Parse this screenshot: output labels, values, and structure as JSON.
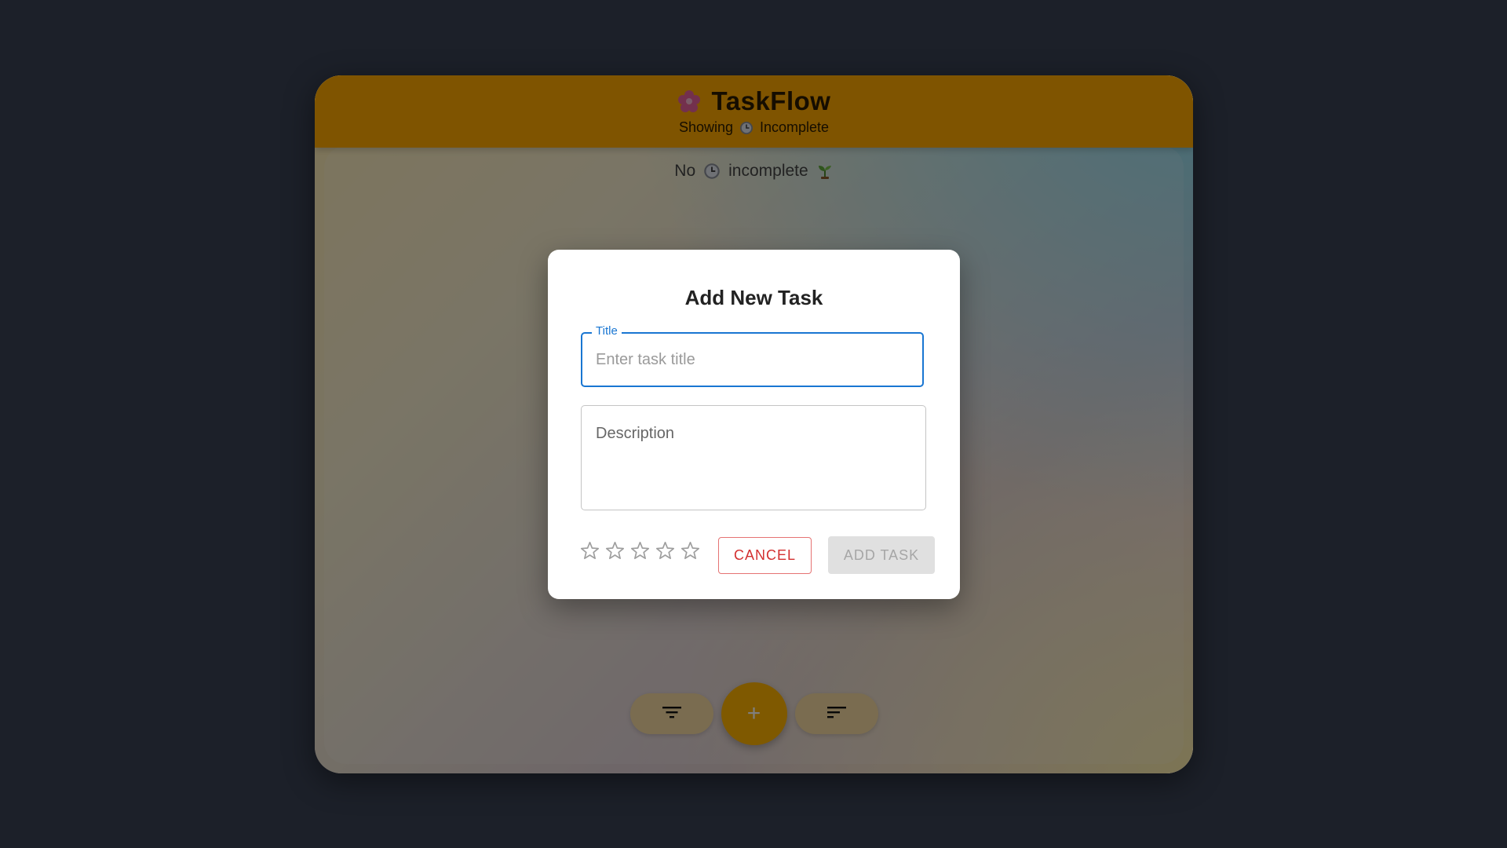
{
  "app": {
    "title": "TaskFlow",
    "logo_icon": "flower-icon",
    "subtitle_prefix": "Showing",
    "subtitle_filter": "Incomplete",
    "accent_color": "#ffa900"
  },
  "main": {
    "empty_prefix": "No",
    "empty_suffix": "incomplete",
    "empty_icon": "seedling-icon"
  },
  "bottom_bar": {
    "filter_icon": "filter-icon",
    "add_icon": "plus-icon",
    "add_symbol": "+",
    "sort_icon": "sort-icon"
  },
  "dialog": {
    "title": "Add New Task",
    "title_field": {
      "label": "Title",
      "placeholder": "Enter task title",
      "value": ""
    },
    "description_field": {
      "placeholder": "Description",
      "value": ""
    },
    "rating": {
      "value": 0,
      "max": 5
    },
    "cancel_label": "CANCEL",
    "add_label": "ADD TASK",
    "cancel_color": "#d32f2f",
    "focus_color": "#1976d2"
  }
}
